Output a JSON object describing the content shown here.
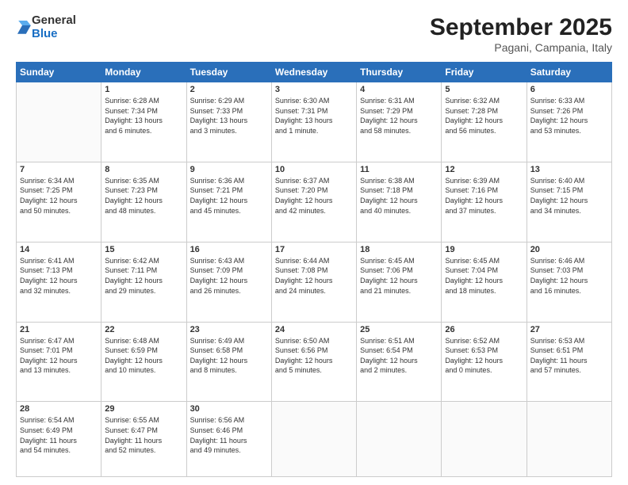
{
  "header": {
    "logo": {
      "general": "General",
      "blue": "Blue"
    },
    "title": "September 2025",
    "subtitle": "Pagani, Campania, Italy"
  },
  "calendar": {
    "weekdays": [
      "Sunday",
      "Monday",
      "Tuesday",
      "Wednesday",
      "Thursday",
      "Friday",
      "Saturday"
    ],
    "weeks": [
      [
        {
          "num": "",
          "info": ""
        },
        {
          "num": "1",
          "info": "Sunrise: 6:28 AM\nSunset: 7:34 PM\nDaylight: 13 hours\nand 6 minutes."
        },
        {
          "num": "2",
          "info": "Sunrise: 6:29 AM\nSunset: 7:33 PM\nDaylight: 13 hours\nand 3 minutes."
        },
        {
          "num": "3",
          "info": "Sunrise: 6:30 AM\nSunset: 7:31 PM\nDaylight: 13 hours\nand 1 minute."
        },
        {
          "num": "4",
          "info": "Sunrise: 6:31 AM\nSunset: 7:29 PM\nDaylight: 12 hours\nand 58 minutes."
        },
        {
          "num": "5",
          "info": "Sunrise: 6:32 AM\nSunset: 7:28 PM\nDaylight: 12 hours\nand 56 minutes."
        },
        {
          "num": "6",
          "info": "Sunrise: 6:33 AM\nSunset: 7:26 PM\nDaylight: 12 hours\nand 53 minutes."
        }
      ],
      [
        {
          "num": "7",
          "info": "Sunrise: 6:34 AM\nSunset: 7:25 PM\nDaylight: 12 hours\nand 50 minutes."
        },
        {
          "num": "8",
          "info": "Sunrise: 6:35 AM\nSunset: 7:23 PM\nDaylight: 12 hours\nand 48 minutes."
        },
        {
          "num": "9",
          "info": "Sunrise: 6:36 AM\nSunset: 7:21 PM\nDaylight: 12 hours\nand 45 minutes."
        },
        {
          "num": "10",
          "info": "Sunrise: 6:37 AM\nSunset: 7:20 PM\nDaylight: 12 hours\nand 42 minutes."
        },
        {
          "num": "11",
          "info": "Sunrise: 6:38 AM\nSunset: 7:18 PM\nDaylight: 12 hours\nand 40 minutes."
        },
        {
          "num": "12",
          "info": "Sunrise: 6:39 AM\nSunset: 7:16 PM\nDaylight: 12 hours\nand 37 minutes."
        },
        {
          "num": "13",
          "info": "Sunrise: 6:40 AM\nSunset: 7:15 PM\nDaylight: 12 hours\nand 34 minutes."
        }
      ],
      [
        {
          "num": "14",
          "info": "Sunrise: 6:41 AM\nSunset: 7:13 PM\nDaylight: 12 hours\nand 32 minutes."
        },
        {
          "num": "15",
          "info": "Sunrise: 6:42 AM\nSunset: 7:11 PM\nDaylight: 12 hours\nand 29 minutes."
        },
        {
          "num": "16",
          "info": "Sunrise: 6:43 AM\nSunset: 7:09 PM\nDaylight: 12 hours\nand 26 minutes."
        },
        {
          "num": "17",
          "info": "Sunrise: 6:44 AM\nSunset: 7:08 PM\nDaylight: 12 hours\nand 24 minutes."
        },
        {
          "num": "18",
          "info": "Sunrise: 6:45 AM\nSunset: 7:06 PM\nDaylight: 12 hours\nand 21 minutes."
        },
        {
          "num": "19",
          "info": "Sunrise: 6:45 AM\nSunset: 7:04 PM\nDaylight: 12 hours\nand 18 minutes."
        },
        {
          "num": "20",
          "info": "Sunrise: 6:46 AM\nSunset: 7:03 PM\nDaylight: 12 hours\nand 16 minutes."
        }
      ],
      [
        {
          "num": "21",
          "info": "Sunrise: 6:47 AM\nSunset: 7:01 PM\nDaylight: 12 hours\nand 13 minutes."
        },
        {
          "num": "22",
          "info": "Sunrise: 6:48 AM\nSunset: 6:59 PM\nDaylight: 12 hours\nand 10 minutes."
        },
        {
          "num": "23",
          "info": "Sunrise: 6:49 AM\nSunset: 6:58 PM\nDaylight: 12 hours\nand 8 minutes."
        },
        {
          "num": "24",
          "info": "Sunrise: 6:50 AM\nSunset: 6:56 PM\nDaylight: 12 hours\nand 5 minutes."
        },
        {
          "num": "25",
          "info": "Sunrise: 6:51 AM\nSunset: 6:54 PM\nDaylight: 12 hours\nand 2 minutes."
        },
        {
          "num": "26",
          "info": "Sunrise: 6:52 AM\nSunset: 6:53 PM\nDaylight: 12 hours\nand 0 minutes."
        },
        {
          "num": "27",
          "info": "Sunrise: 6:53 AM\nSunset: 6:51 PM\nDaylight: 11 hours\nand 57 minutes."
        }
      ],
      [
        {
          "num": "28",
          "info": "Sunrise: 6:54 AM\nSunset: 6:49 PM\nDaylight: 11 hours\nand 54 minutes."
        },
        {
          "num": "29",
          "info": "Sunrise: 6:55 AM\nSunset: 6:47 PM\nDaylight: 11 hours\nand 52 minutes."
        },
        {
          "num": "30",
          "info": "Sunrise: 6:56 AM\nSunset: 6:46 PM\nDaylight: 11 hours\nand 49 minutes."
        },
        {
          "num": "",
          "info": ""
        },
        {
          "num": "",
          "info": ""
        },
        {
          "num": "",
          "info": ""
        },
        {
          "num": "",
          "info": ""
        }
      ]
    ]
  }
}
